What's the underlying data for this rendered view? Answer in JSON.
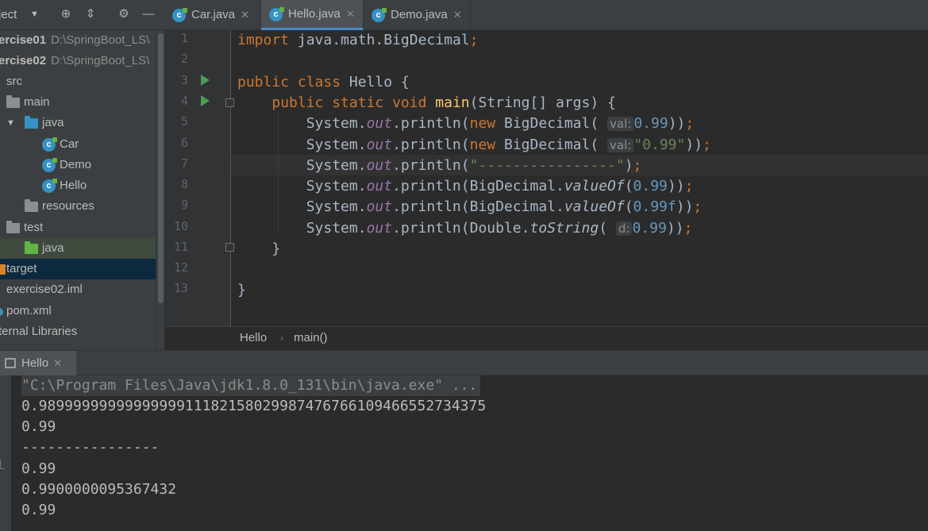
{
  "project_panel": {
    "title": "ject",
    "items": [
      {
        "label": "ercise01",
        "path": "D:\\SpringBoot_LS\\"
      },
      {
        "label": "ercise02",
        "path": "D:\\SpringBoot_LS\\"
      },
      {
        "label": "src"
      },
      {
        "label": "main"
      },
      {
        "label": "java"
      },
      {
        "label": "Car"
      },
      {
        "label": "Demo"
      },
      {
        "label": "Hello"
      },
      {
        "label": "resources"
      },
      {
        "label": "test"
      },
      {
        "label": "java"
      },
      {
        "label": "target"
      },
      {
        "label": "exercise02.iml"
      },
      {
        "label": "pom.xml"
      },
      {
        "label": "ternal Libraries"
      }
    ]
  },
  "tabs": [
    {
      "label": "Car.java"
    },
    {
      "label": "Hello.java"
    },
    {
      "label": "Demo.java"
    }
  ],
  "editor": {
    "line_numbers": [
      "1",
      "2",
      "3",
      "4",
      "5",
      "6",
      "7",
      "8",
      "9",
      "10",
      "11",
      "12",
      "13"
    ],
    "code": {
      "l1_import": "import",
      "l1_rest": " java.math.BigDecimal",
      "l1_semi": ";",
      "l3_public": "public class",
      "l3_rest": " Hello {",
      "l4_mods": "public static void",
      "l4_main": "main",
      "l4_rest": "(String[] args) {",
      "system": "System.",
      "out": "out",
      "println": ".println(",
      "new": "new",
      "bigdecimal_ctor": " BigDecimal(",
      "hint_val": "val:",
      "hint_d": "d:",
      "n_099": "0.99",
      "s_099": "\"0.99\"",
      "s_dashes": "\"----------------\"",
      "close2": "))",
      "close1": ")",
      "semi": ";",
      "bigdecimal_dot": "BigDecimal.",
      "valueof": "valueOf",
      "paren": "(",
      "n_099f": "0.99f",
      "double_dot": "Double.",
      "tostring": "toString",
      "brace": "}"
    }
  },
  "breadcrumb": {
    "items": [
      "Hello",
      "main()"
    ]
  },
  "run_panel": {
    "tab_label": "Hello",
    "output": [
      "\"C:\\Program Files\\Java\\jdk1.8.0_131\\bin\\java.exe\" ...",
      "0.9899999999999999911182158029987476766109466552734375",
      "0.99",
      "----------------",
      "0.99",
      "0.9900000095367432",
      "0.99"
    ]
  }
}
